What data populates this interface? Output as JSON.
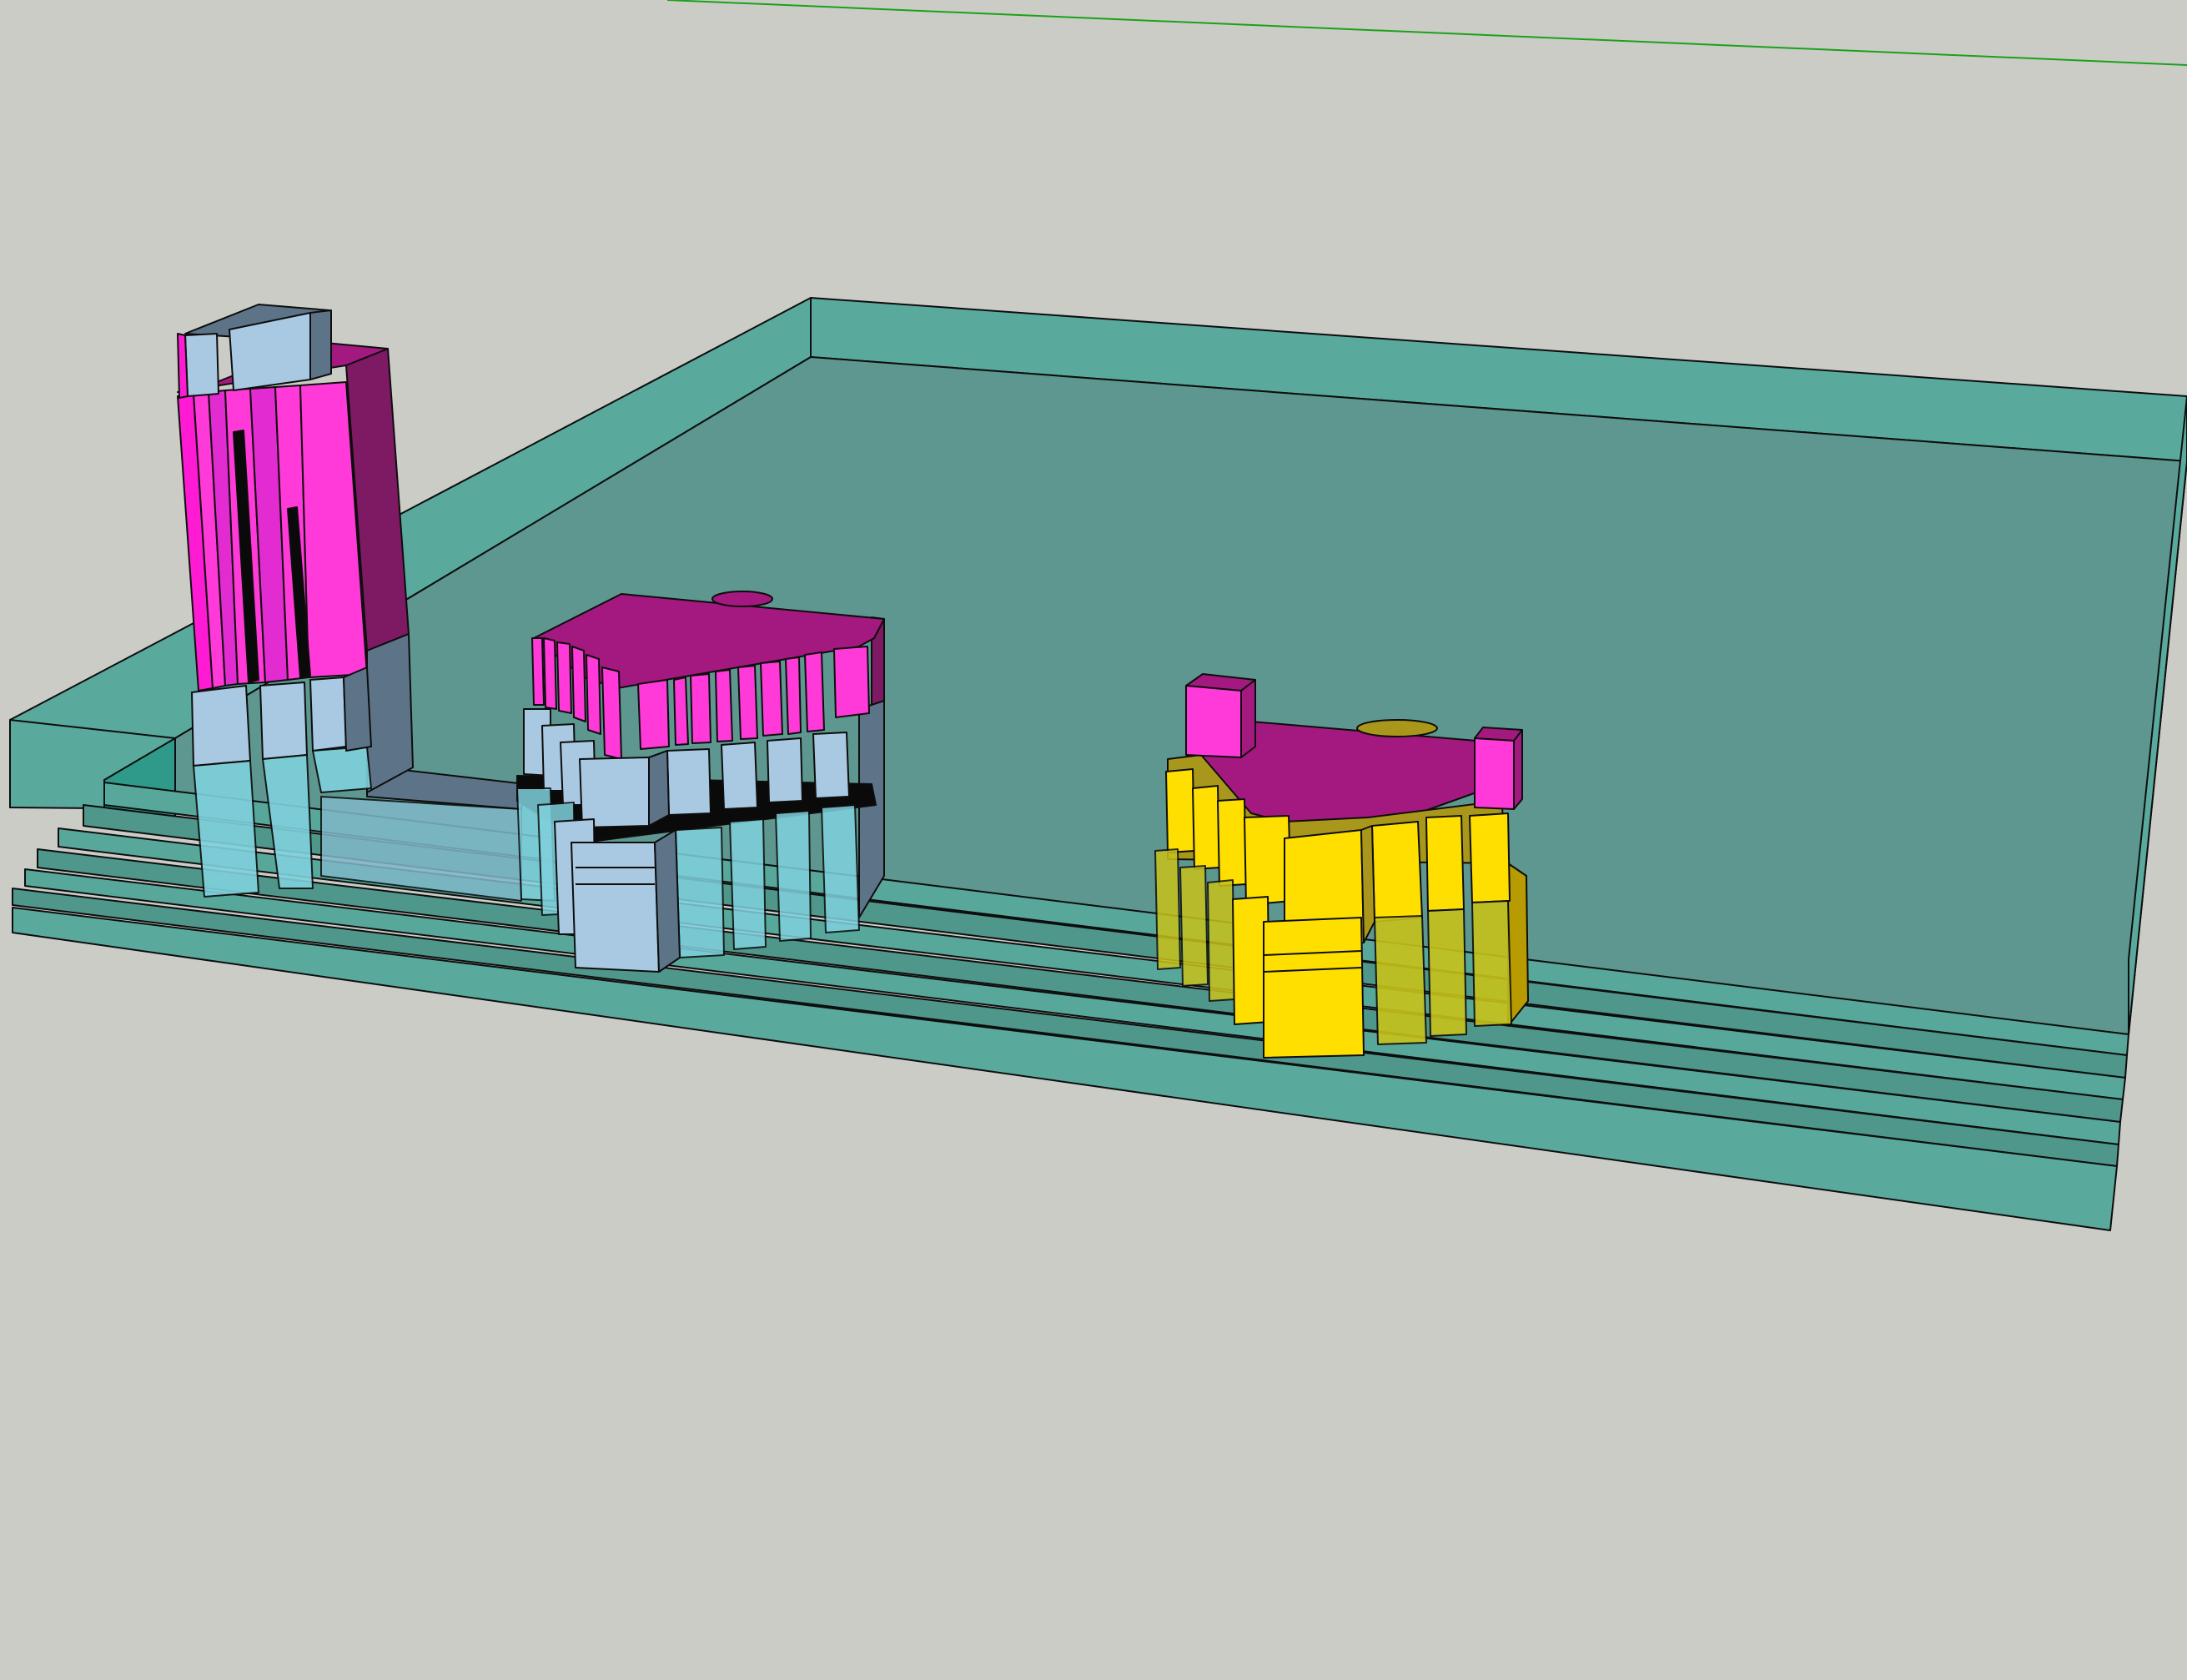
{
  "scene": {
    "background_color": "#ccccc6",
    "axis_color": "#1aa11a",
    "materials": {
      "glass_slab": "#5aa99d",
      "glass_slab_dark": "#4f968b",
      "glass_top": "#5e978f",
      "pink_bright": "#ff3ad8",
      "pink_mid": "#e22bd0",
      "magenta": "#a3197f",
      "magenta_dark": "#7e1963",
      "light_blue": "#a9c9e2",
      "blue_grey": "#5d7488",
      "translucent_cyan": "#7fd1dd",
      "yellow": "#ffdf00",
      "yellow_dark": "#b89b00",
      "olive": "#a8971a",
      "black": "#0a0a0a"
    },
    "objects": [
      {
        "label": "tall-tower-model",
        "colors": [
          "pink_bright",
          "magenta",
          "light_blue"
        ]
      },
      {
        "label": "stepped-block-model-center",
        "colors": [
          "magenta",
          "pink_bright",
          "light_blue"
        ]
      },
      {
        "label": "stepped-block-model-right",
        "colors": [
          "magenta",
          "yellow",
          "pink_bright"
        ]
      },
      {
        "label": "layered-base-plate",
        "colors": [
          "glass_slab"
        ]
      }
    ]
  }
}
